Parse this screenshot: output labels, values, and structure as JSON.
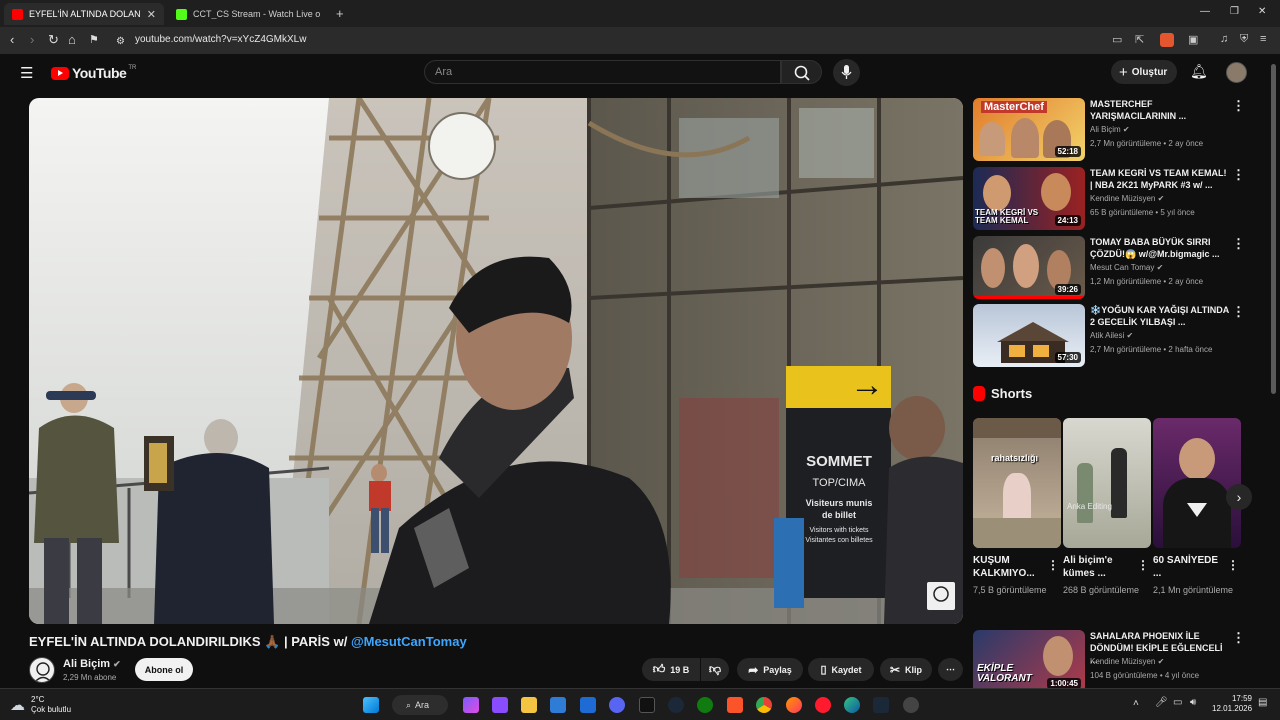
{
  "browser": {
    "tabs": [
      {
        "label": "EYFEL'İN ALTINDA DOLANDIRI",
        "active": true
      },
      {
        "label": "CCT_CS Stream - Watch Live on Kick",
        "active": false
      }
    ],
    "url": "youtube.com/watch?v=xYcZ4GMkXLw"
  },
  "youtube": {
    "logo_text": "YouTube",
    "region": "TR",
    "search_placeholder": "Ara",
    "create_label": "Oluştur"
  },
  "video": {
    "title": "EYFEL'İN ALTINDA DOLANDIRILDIKS 🙏🏾 | PARİS w/",
    "mention": "@MesutCanTomay",
    "sign_text": [
      "SOMMET",
      "TOP/CIMA",
      "Visiteurs munis",
      "de billet",
      "Visitors with tickets",
      "Visitantes con billetes"
    ]
  },
  "channel": {
    "name": "Ali Biçim",
    "subs": "2,29 Mn abone",
    "subscribe_label": "Abone ol"
  },
  "actions": {
    "likes": "19 B",
    "share": "Paylaş",
    "save": "Kaydet",
    "clip": "Klip"
  },
  "recommendations": [
    {
      "title": "MASTERCHEF YARIŞMACILARININ ...",
      "channel": "Ali Biçim",
      "meta": "2,7 Mn görüntüleme • 2 ay önce",
      "duration": "52:18",
      "thumb_text": "MasterChef"
    },
    {
      "title": "TEAM KEGRİ VS TEAM KEMAL! | NBA 2K21 MyPARK #3 w/ ...",
      "channel": "Kendine Müzisyen",
      "meta": "65 B görüntüleme • 5 yıl önce",
      "duration": "24:13",
      "thumb_text": "TEAM KEGRİ VS TEAM KEMAL"
    },
    {
      "title": "TOMAY BABA BÜYÜK SIRRI ÇÖZDÜ!😱 w/@Mr.bigmagic ...",
      "channel": "Mesut Can Tomay",
      "meta": "1,2 Mn görüntüleme • 2 ay önce",
      "duration": "39:26",
      "thumb_text": ""
    },
    {
      "title": "❄️YOĞUN KAR YAĞIŞI ALTINDA 2 GECELİK YILBAŞI ...",
      "channel": "Atik Ailesi",
      "meta": "2,7 Mn görüntüleme • 2 hafta önce",
      "duration": "57:30",
      "thumb_text": ""
    },
    {
      "title": "SAHALARA PHOENIX İLE DÖNDÜM! EKİPLE EĞLENCELİ ...",
      "channel": "Kendine Müzisyen",
      "meta": "104 B görüntüleme • 4 yıl önce",
      "duration": "1:00:45",
      "thumb_text": "EKİPLE VALORANT"
    }
  ],
  "shorts": {
    "heading": "Shorts",
    "items": [
      {
        "title": "KUŞUM KALKMIYO...",
        "views": "7,5 B görüntüleme",
        "overlay": "rahatsızlığı"
      },
      {
        "title": "Ali biçim'e kümes ...",
        "views": "268 B görüntüleme",
        "overlay": "Anka Editing"
      },
      {
        "title": "60 SANİYEDE ...",
        "views": "2,1 Mn görüntüleme",
        "overlay": ""
      }
    ]
  },
  "taskbar": {
    "weather_temp": "2°C",
    "weather_desc": "Çok bulutlu",
    "search_label": "Ara",
    "time": "17:59",
    "date": "12.01.2026"
  }
}
